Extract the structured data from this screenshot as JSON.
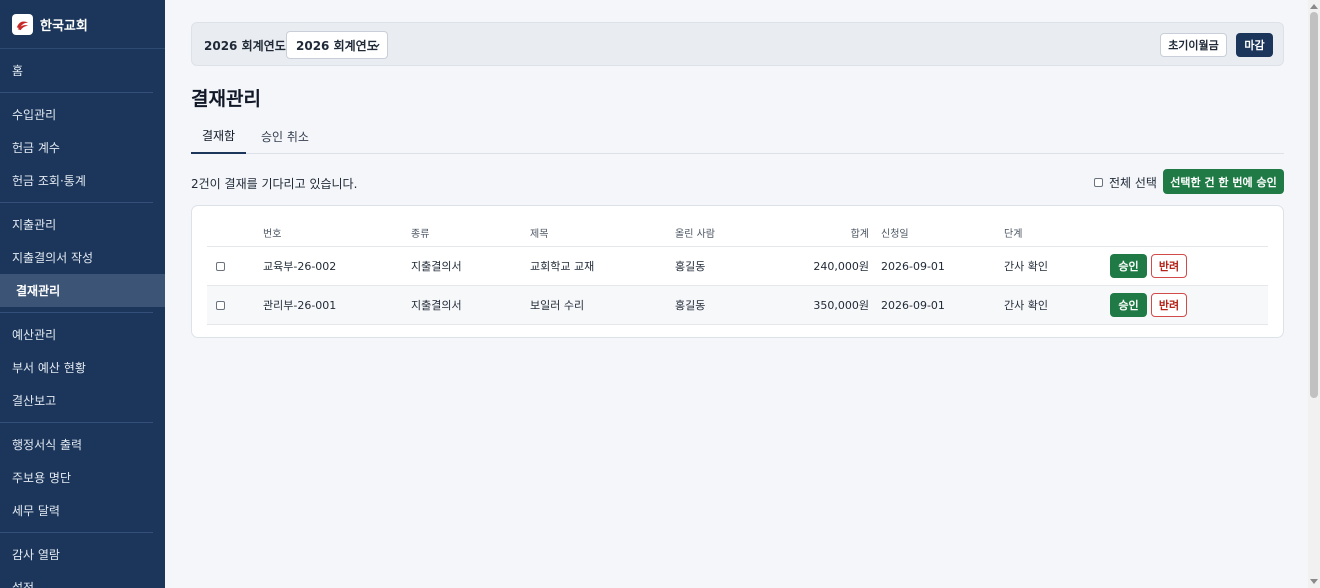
{
  "sidebar": {
    "brand": "한국교회",
    "items": [
      {
        "label": "홈"
      },
      {
        "label": "수입관리"
      },
      {
        "label": "헌금 계수"
      },
      {
        "label": "헌금 조회·통계"
      },
      {
        "label": "지출관리"
      },
      {
        "label": "지출결의서 작성"
      },
      {
        "label": "결재관리"
      },
      {
        "label": "예산관리"
      },
      {
        "label": "부서 예산 현황"
      },
      {
        "label": "결산보고"
      },
      {
        "label": "행정서식 출력"
      },
      {
        "label": "주보용 명단"
      },
      {
        "label": "세무 달력"
      },
      {
        "label": "감사 열람"
      },
      {
        "label": "설정"
      }
    ]
  },
  "topbar": {
    "fiscal_year_label": "2026 회계연도",
    "fiscal_year_selected": "2026 회계연도",
    "opening_balance_button": "초기이월금",
    "close_button": "마감"
  },
  "page": {
    "title": "결재관리",
    "tabs": [
      {
        "label": "결재함",
        "active": true
      },
      {
        "label": "승인 취소",
        "active": false
      }
    ],
    "pending_text": "2건이 결재를 기다리고 있습니다.",
    "select_all_label": "전체 선택",
    "bulk_approve_button": "선택한 건 한 번에 승인"
  },
  "table": {
    "headers": {
      "number": "번호",
      "type": "종류",
      "title": "제목",
      "submitter": "올린 사람",
      "total": "합계",
      "request_date": "신청일",
      "stage": "단계"
    },
    "rows": [
      {
        "number": "교육부-26-002",
        "type": "지출결의서",
        "title": "교회학교 교재",
        "submitter": "홍길동",
        "total": "240,000원",
        "request_date": "2026-09-01",
        "stage": "간사 확인",
        "approve": "승인",
        "reject": "반려"
      },
      {
        "number": "관리부-26-001",
        "type": "지출결의서",
        "title": "보일러 수리",
        "submitter": "홍길동",
        "total": "350,000원",
        "request_date": "2026-09-01",
        "stage": "간사 확인",
        "approve": "승인",
        "reject": "반려"
      }
    ]
  },
  "colors": {
    "sidebar_bg": "#1b365a",
    "primary_navy": "#1b365a",
    "approve_green": "#1f7a45",
    "reject_red": "#b42318",
    "page_bg": "#f4f6f9"
  },
  "icons": {
    "brand": "church-logo-icon",
    "select": "chevron-down-icon"
  }
}
